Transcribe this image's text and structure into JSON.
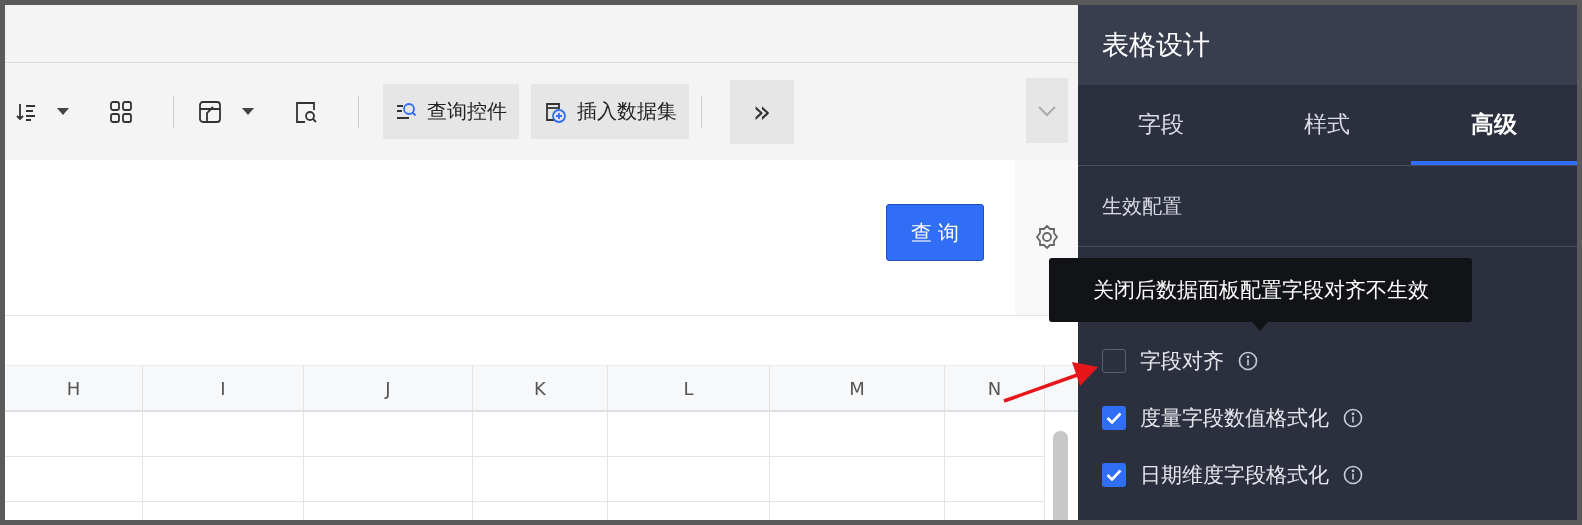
{
  "toolbar": [
    {
      "kind": "sort",
      "dropdown": true
    },
    {
      "kind": "grid",
      "dropdown": false
    },
    {
      "kind": "divider"
    },
    {
      "kind": "chart",
      "dropdown": true
    },
    {
      "kind": "preview",
      "dropdown": false
    },
    {
      "kind": "divider"
    },
    {
      "kind": "query-button",
      "label": "查询控件"
    },
    {
      "kind": "dataset-button",
      "label": "插入数据集"
    },
    {
      "kind": "divider"
    },
    {
      "kind": "more",
      "label": "»"
    }
  ],
  "query_button": {
    "label": "查 询"
  },
  "table": {
    "columns": [
      "H",
      "I",
      "J",
      "K",
      "L",
      "M",
      "N"
    ]
  },
  "panel": {
    "title": "表格设计",
    "tabs": [
      {
        "label": "字段",
        "selected": false
      },
      {
        "label": "样式",
        "selected": false
      },
      {
        "label": "高级",
        "selected": true
      }
    ],
    "section": "生效配置",
    "options": [
      {
        "label": "字段对齐",
        "checked": false
      },
      {
        "label": "度量字段数值格式化",
        "checked": true
      },
      {
        "label": "日期维度字段格式化",
        "checked": true
      }
    ],
    "tooltip": "关闭后数据面板配置字段对齐不生效"
  }
}
